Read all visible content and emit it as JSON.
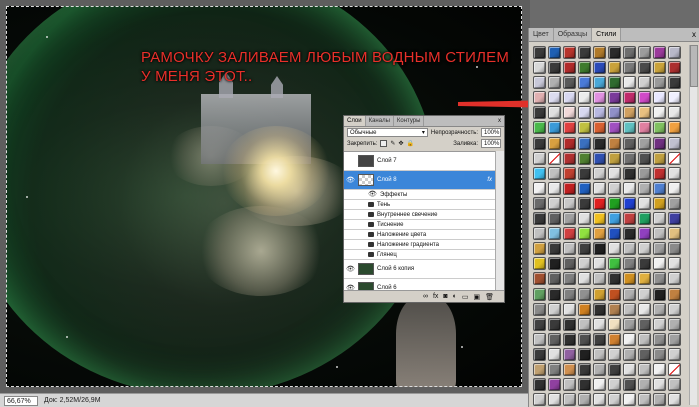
{
  "caption": {
    "line1": "РАМОЧКУ ЗАЛИВАЕМ ЛЮБЫМ ВОДНЫМ СТИЛЕМ",
    "line2": "У МЕНЯ ЭТОТ.."
  },
  "status_bar": {
    "zoom": "66,67%",
    "doc": "Док: 2,52M/26,9M"
  },
  "styles_panel": {
    "tabs": [
      "Цвет",
      "Образцы",
      "Стили"
    ],
    "active_tab": "Стили",
    "close_glyph": "x",
    "swatch_colors": [
      "#3a3a3a",
      "#1e5fb3",
      "#b7342b",
      "#3a3a3a",
      "#b07a2a",
      "#2b2b2b",
      "#6e6e6e",
      "#9c9c9c",
      "#9b3a9b",
      "#b8b8c8",
      "#d8d8d8",
      "#3a3a3a",
      "#b02a2a",
      "#3e7b2d",
      "#2a4ab8",
      "#c9a23a",
      "#7a7a7a",
      "#4a4a4a",
      "#c9a23a",
      "#ac2f2f",
      "#c8c8d8",
      "#b0b0b0",
      "#5a5a5a",
      "#4a7ad8",
      "#4aa8d8",
      "#2f6b2f",
      "#e8e8e8",
      "#d0d0d0",
      "#9a9a9a",
      "#3a3a3a",
      "#e0b0b0",
      "#dcdcf0",
      "#d8d8f0",
      "#ececec",
      "#e090e0",
      "#7a3a9a",
      "#c02a6a",
      "#d04ac8",
      "#e8e8ff",
      "#f0f0ff",
      "#3a3a3a",
      "#e0e0e0",
      "#f0d8d8",
      "#d8d8f0",
      "#b8b8e0",
      "#9090c8",
      "#d0a060",
      "#e8c080",
      "#f0f0f0",
      "#e8e8e8",
      "#4ab84a",
      "#3a9ad8",
      "#e04040",
      "#c0c040",
      "#d86030",
      "#a050c0",
      "#60c0c0",
      "#e080a0",
      "#80c060",
      "#f0a040",
      "#3a3a3a",
      "#d8a040",
      "#b02a2a",
      "#3a70c0",
      "#2a2a2a",
      "#c08040",
      "#606060",
      "#a0a0a0",
      "#703080",
      "#c0c0d0",
      "#d0d0d0",
      "none",
      "#b03030",
      "#508030",
      "#3050b0",
      "#c0a040",
      "#707070",
      "#505050",
      "#c0a040",
      "none",
      "#40c0f0",
      "#c0c0c0",
      "#c04030",
      "#3a3a3a",
      "#d0d0d0",
      "#e0e0e0",
      "#303030",
      "#9a9a9a",
      "#c03030",
      "#e0e0e0",
      "#f0f0f0",
      "#e8e8e8",
      "#c02020",
      "#2060c0",
      "#e0e0e0",
      "#d0d0d0",
      "#e8e8e8",
      "#b0b0b0",
      "#5080d0",
      "#f0f0f0",
      "#6a6a6a",
      "#d0d0d0",
      "#c8c8c8",
      "#3a3a3a",
      "#e02020",
      "#20a020",
      "#2040d0",
      "#e0e0e0",
      "#d0a020",
      "#a0a0a0",
      "#3a3a3a",
      "#606060",
      "#a0a0a0",
      "#e0e0e0",
      "#f0c020",
      "#40a0e0",
      "#c04040",
      "#20a060",
      "#d0d0d0",
      "#4040a0",
      "#c0c0c0",
      "#80c0e0",
      "#d04040",
      "#90e040",
      "#e0a040",
      "#2050c0",
      "#2a2a2a",
      "#9040c0",
      "#c0c0c0",
      "#e0c080",
      "#d0a040",
      "#3a3a3a",
      "#c0c0c0",
      "#404040",
      "#202020",
      "#e0e0e0",
      "#c0c0c0",
      "#d0d0d0",
      "#a0a0a0",
      "#8a8a8a",
      "#e0c020",
      "#202020",
      "#606060",
      "#d0d0d0",
      "#e0e0e0",
      "#40c040",
      "#808080",
      "#3a3a3a",
      "#f0f0f0",
      "#e0e0e0",
      "#a05030",
      "#606060",
      "#808080",
      "#e0e0e0",
      "#c0c0c0",
      "#303030",
      "#d09020",
      "#e0b040",
      "#909090",
      "#d0d0d0",
      "#60a060",
      "#2a2a2a",
      "#808080",
      "#909090",
      "#d0a030",
      "#c05020",
      "#b0b0b0",
      "#d0d0d0",
      "#202020",
      "#c08040",
      "#8a8a8a",
      "#d0d0d0",
      "#e0e0e0",
      "#d08020",
      "#303030",
      "#b08050",
      "#c0c0c0",
      "#e8e8e8",
      "#b0b0b0",
      "#d0d0d0",
      "#404040",
      "#3a3a3a",
      "#303030",
      "#c0c0c0",
      "#e0e0e0",
      "#f0e0c0",
      "#a0a0a0",
      "#606060",
      "#d0d0d0",
      "#b0b0b0",
      "#c0c0c0",
      "#606060",
      "#303030",
      "#505050",
      "#404040",
      "#d08030",
      "#f0f0f0",
      "#c0c0c0",
      "#909090",
      "#a0a0a0",
      "#3a3a3a",
      "#e0e0e0",
      "#9060a0",
      "#202020",
      "#c0c0c0",
      "#d0d0d0",
      "#b0b0b0",
      "#606060",
      "#8a8a8a",
      "#d0d0d0",
      "#c0a070",
      "#808080",
      "#d09050",
      "#3a3a3a",
      "#b0b0b0",
      "#404040",
      "#e0e0e0",
      "#c0c0c0",
      "#f0f0f0",
      "none",
      "#303030",
      "#9040a0",
      "#c0c0c0",
      "#303030",
      "#f0f0f0",
      "#d0d0d0",
      "#505050",
      "#b0b0b0",
      "#e0e0e0",
      "#c0c0c0",
      "#d0d0d0",
      "#e0e0e0",
      "#c0c0c0",
      "#b0b0b0",
      "#e0e0e0",
      "#d0d0d0",
      "#f0f0f0",
      "#c0c0c0",
      "#b0b0b0",
      "#e0e0e0"
    ]
  },
  "layers_panel": {
    "tabs": [
      "Слои",
      "Каналы",
      "Контуры"
    ],
    "active_tab": "Слои",
    "close_glyph": "x",
    "blend_mode": "Обычные",
    "opacity_label": "Непрозрачность:",
    "opacity_value": "100%",
    "lock_label": "Закрепить:",
    "fill_label": "Заливка:",
    "fill_value": "100%",
    "layers": [
      {
        "name": "Слой 7",
        "active": false,
        "kind": "thumb"
      },
      {
        "name": "Слой 8",
        "active": true,
        "kind": "checker",
        "fx": "fx"
      }
    ],
    "effects_label": "Эффекты",
    "effects": [
      "Тень",
      "Внутреннее свечение",
      "Тиснение",
      "Наложение цвета",
      "Наложение градиента",
      "Глянец"
    ],
    "bottom_layers": [
      {
        "name": "Слой 6 копия"
      },
      {
        "name": "Слой 6"
      }
    ],
    "bottom_icons": [
      "link-icon",
      "fx-icon",
      "mask-icon",
      "adjustment-icon",
      "group-icon",
      "new-layer-icon",
      "trash-icon"
    ],
    "bottom_glyphs": [
      "∞",
      "fx",
      "◙",
      "◐",
      "▭",
      "▣",
      "🗑"
    ]
  },
  "colors": {
    "arrow": "#e0302a",
    "caption": "#e8302a",
    "active_layer": "#3b86d9"
  }
}
